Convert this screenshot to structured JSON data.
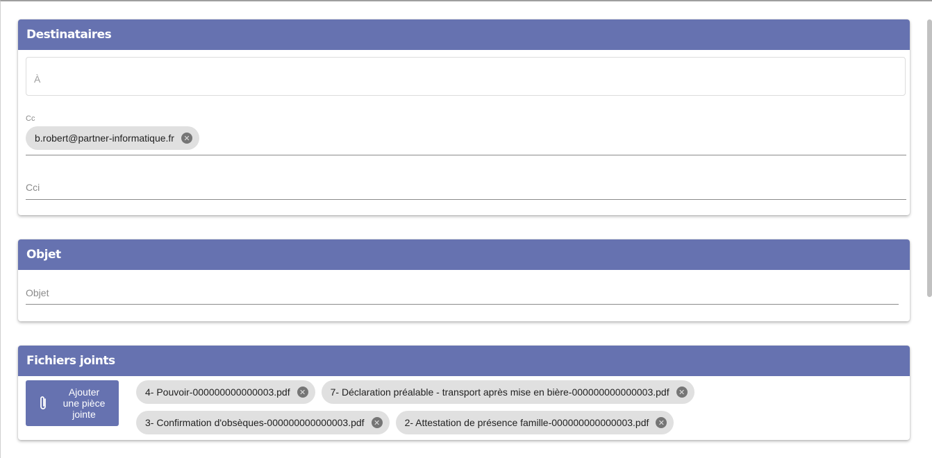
{
  "recipients": {
    "header": "Destinataires",
    "to_placeholder": "À",
    "cc_label": "Cc",
    "cc_chips": [
      "b.robert@partner-informatique.fr"
    ],
    "cci_placeholder": "Cci"
  },
  "subject": {
    "header": "Objet",
    "placeholder": "Objet"
  },
  "attachments": {
    "header": "Fichiers joints",
    "add_button": [
      "Ajouter",
      "une pièce",
      "jointe"
    ],
    "files": [
      "4- Pouvoir-000000000000003.pdf",
      "7- Déclaration préalable - transport après mise en bière-000000000000003.pdf",
      "3- Confirmation d'obsèques-000000000000003.pdf",
      "2- Attestation de présence famille-000000000000003.pdf"
    ]
  },
  "icons": {
    "chip_remove": "close-circle-icon",
    "attach": "paperclip-icon"
  },
  "colors": {
    "header_bg": "#6672b0",
    "chip_bg": "#e0e0e0"
  }
}
